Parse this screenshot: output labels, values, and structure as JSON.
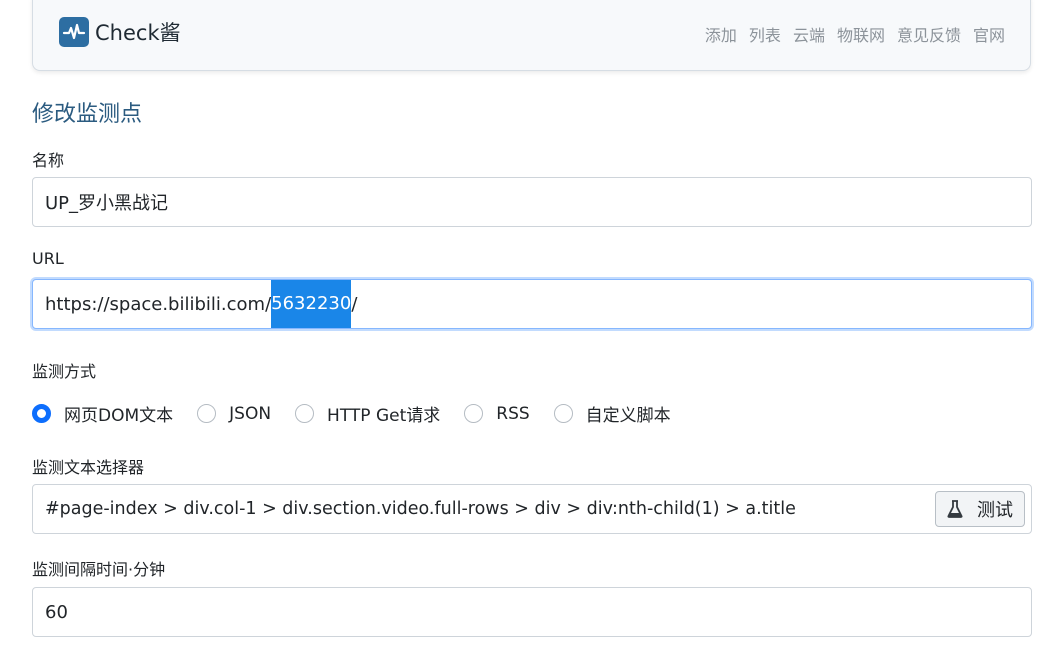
{
  "navbar": {
    "brand": "Check酱",
    "links": [
      "添加",
      "列表",
      "云端",
      "物联网",
      "意见反馈",
      "官网"
    ]
  },
  "form": {
    "title": "修改监测点",
    "name_label": "名称",
    "name_value": "UP_罗小黑战记",
    "url_label": "URL",
    "url_prefix": "https://space.bilibili.com/",
    "url_selected": "5632230",
    "url_suffix": "/",
    "method_label": "监测方式",
    "methods": [
      "网页DOM文本",
      "JSON",
      "HTTP Get请求",
      "RSS",
      "自定义脚本"
    ],
    "selected_method": "网页DOM文本",
    "selector_label": "监测文本选择器",
    "selector_value": "#page-index > div.col-1 > div.section.video.full-rows > div > div:nth-child(1) > a.title",
    "test_button": "测试",
    "interval_label": "监测间隔时间·分钟",
    "interval_value": "60"
  }
}
